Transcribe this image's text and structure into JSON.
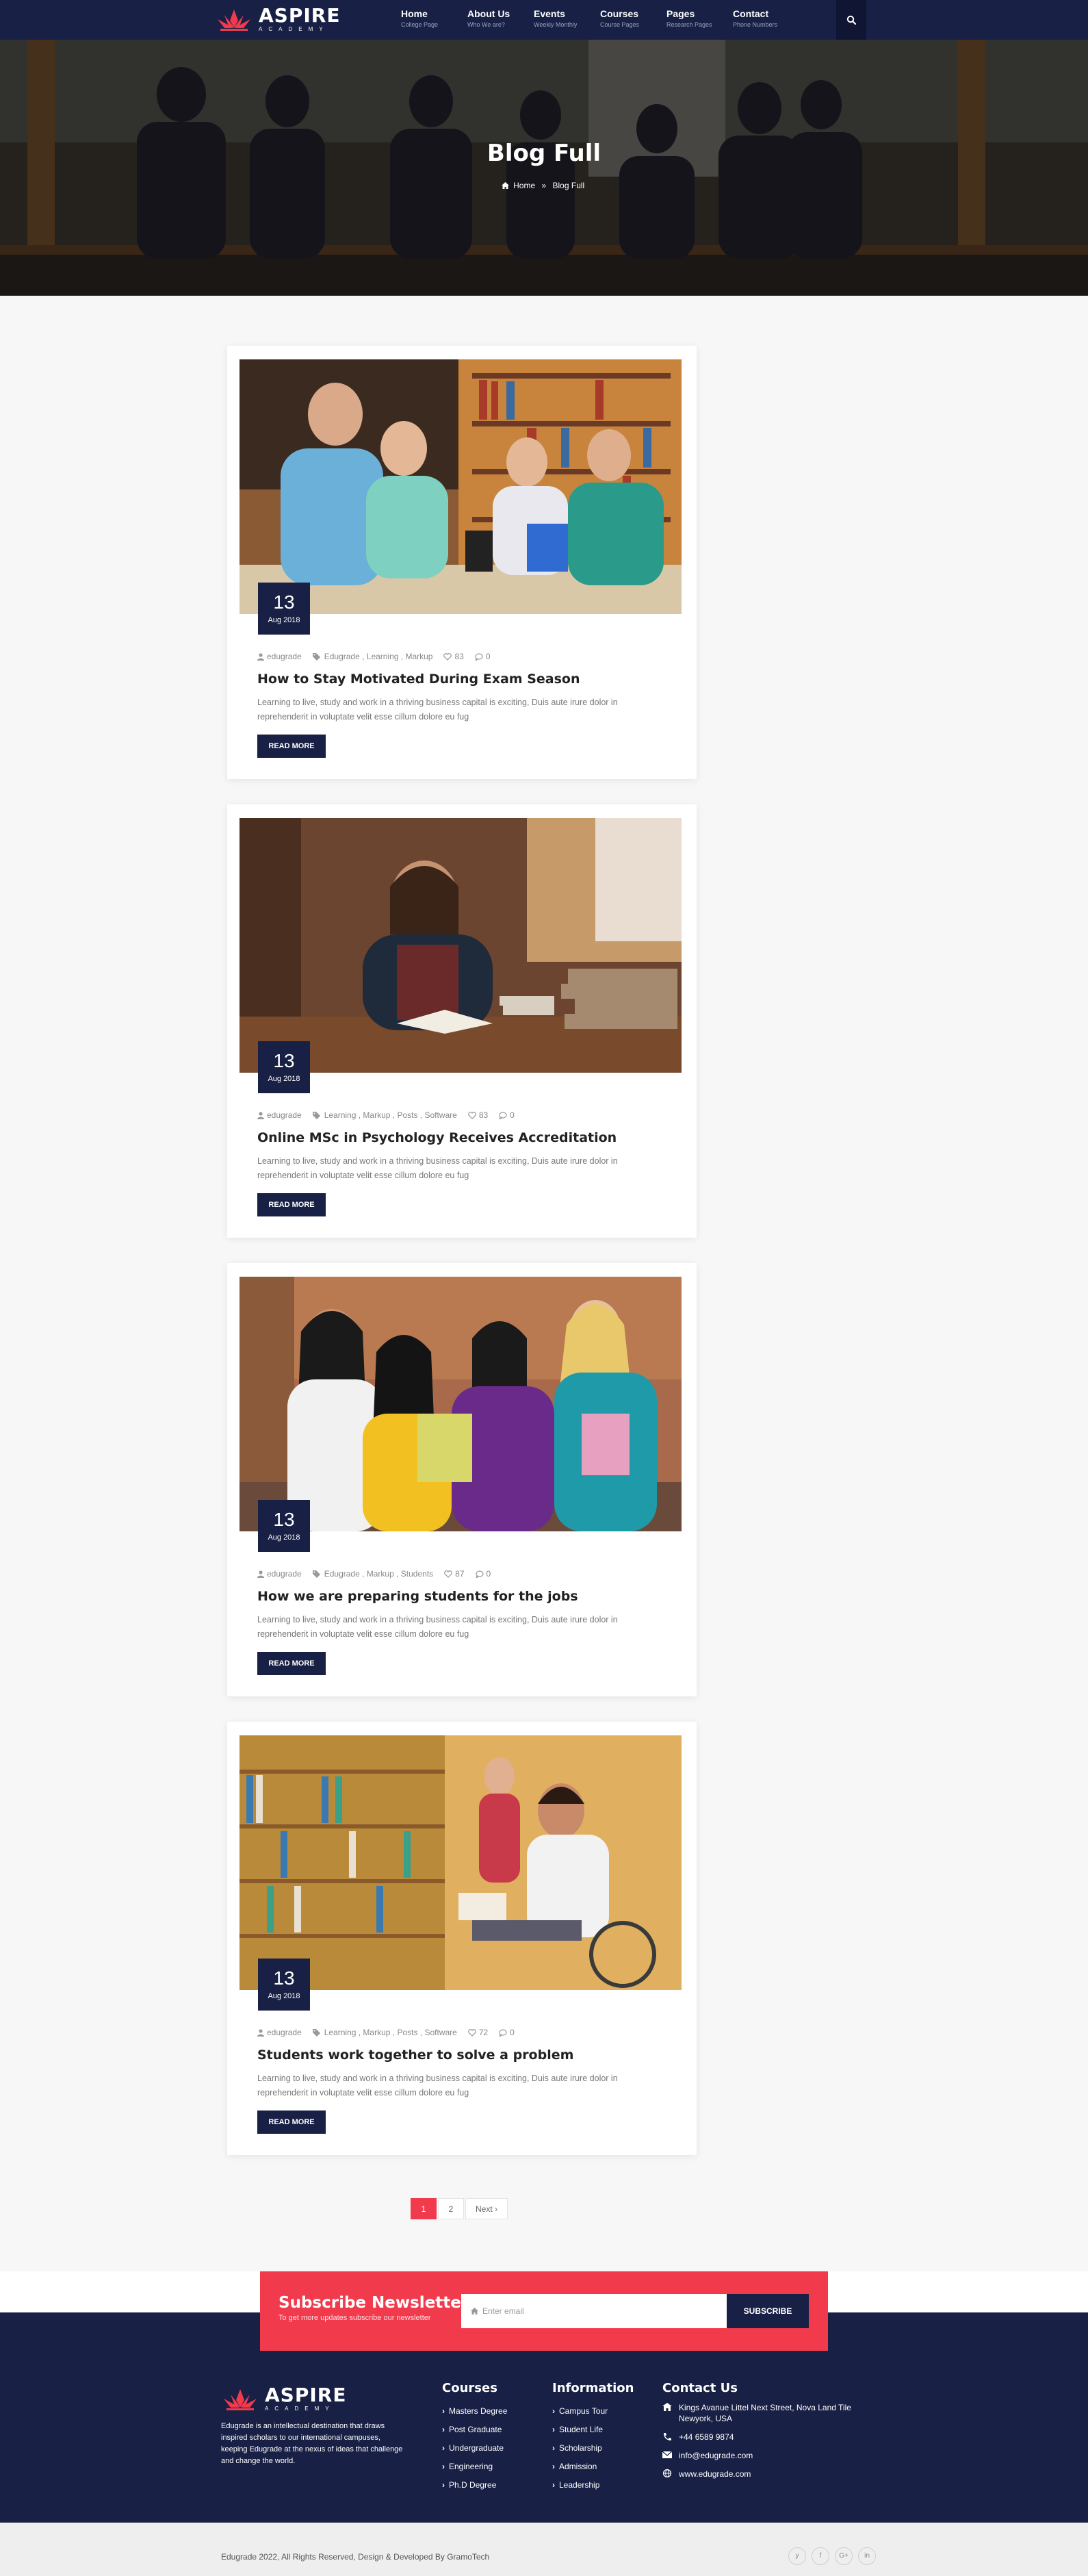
{
  "brand": {
    "name": "ASPIRE",
    "tagline": "ACADEMY"
  },
  "nav": {
    "items": [
      {
        "title": "Home",
        "sub": "College Page"
      },
      {
        "title": "About Us",
        "sub": "Who We are?"
      },
      {
        "title": "Events",
        "sub": "Weekly Monthly"
      },
      {
        "title": "Courses",
        "sub": "Course Pages"
      },
      {
        "title": "Pages",
        "sub": "Research Pages"
      },
      {
        "title": "Contact",
        "sub": "Phone Numbers"
      }
    ],
    "search_icon": "search-icon"
  },
  "hero": {
    "title": "Blog Full",
    "breadcrumb": {
      "home": "Home",
      "separator": "»",
      "current": "Blog Full"
    }
  },
  "posts": [
    {
      "day": "13",
      "month": "Aug 2018",
      "author": "edugrade",
      "tags": "Edugrade , Learning , Markup",
      "likes": "83",
      "comments": "0",
      "title": "How to Stay Motivated During Exam Season",
      "excerpt": "Learning to live, study and work in a thriving business capital is exciting, Duis aute irure dolor in reprehenderit in voluptate velit esse cillum dolore eu fug",
      "button": "READ MORE"
    },
    {
      "day": "13",
      "month": "Aug 2018",
      "author": "edugrade",
      "tags": "Learning , Markup , Posts , Software",
      "likes": "83",
      "comments": "0",
      "title": "Online MSc in Psychology Receives Accreditation",
      "excerpt": "Learning to live, study and work in a thriving business capital is exciting, Duis aute irure dolor in reprehenderit in voluptate velit esse cillum dolore eu fug",
      "button": "READ MORE"
    },
    {
      "day": "13",
      "month": "Aug 2018",
      "author": "edugrade",
      "tags": "Edugrade , Markup , Students",
      "likes": "87",
      "comments": "0",
      "title": "How we are preparing students for the jobs",
      "excerpt": "Learning to live, study and work in a thriving business capital is exciting, Duis aute irure dolor in reprehenderit in voluptate velit esse cillum dolore eu fug",
      "button": "READ MORE"
    },
    {
      "day": "13",
      "month": "Aug 2018",
      "author": "edugrade",
      "tags": "Learning , Markup , Posts , Software",
      "likes": "72",
      "comments": "0",
      "title": "Students work together to solve a problem",
      "excerpt": "Learning to live, study and work in a thriving business capital is exciting, Duis aute irure dolor in reprehenderit in voluptate velit esse cillum dolore eu fug",
      "button": "READ MORE"
    }
  ],
  "pagination": {
    "pages": [
      "1",
      "2"
    ],
    "next": "Next",
    "active": "1"
  },
  "newsletter": {
    "title": "Subscribe Newsletter",
    "subtitle": "To get more updates subscribe our newsletter",
    "placeholder": "Enter email",
    "button": "SUBSCRIBE"
  },
  "footer": {
    "about": "Edugrade is an intellectual destination that draws inspired scholars to our international campuses, keeping Edugrade at the nexus of ideas that challenge and change the world.",
    "courses": {
      "title": "Courses",
      "items": [
        "Masters Degree",
        "Post Graduate",
        "Undergraduate",
        "Engineering",
        "Ph.D Degree"
      ]
    },
    "information": {
      "title": "Information",
      "items": [
        "Campus Tour",
        "Student Life",
        "Scholarship",
        "Admission",
        "Leadership"
      ]
    },
    "contact": {
      "title": "Contact Us",
      "address": "Kings Avanue Littel Next Street, Nova Land Tile Newyork, USA",
      "phone": "+44 6589 9874",
      "email": "info@edugrade.com",
      "website": "www.edugrade.com"
    }
  },
  "copyright": {
    "text": "Edugrade 2022, All Rights Reserved, Design & Developed By GramoTech",
    "social": [
      "y",
      "f",
      "G+",
      "in"
    ]
  },
  "colors": {
    "navy": "#182045",
    "accent": "#f23a4d",
    "background": "#f7f7f7"
  }
}
